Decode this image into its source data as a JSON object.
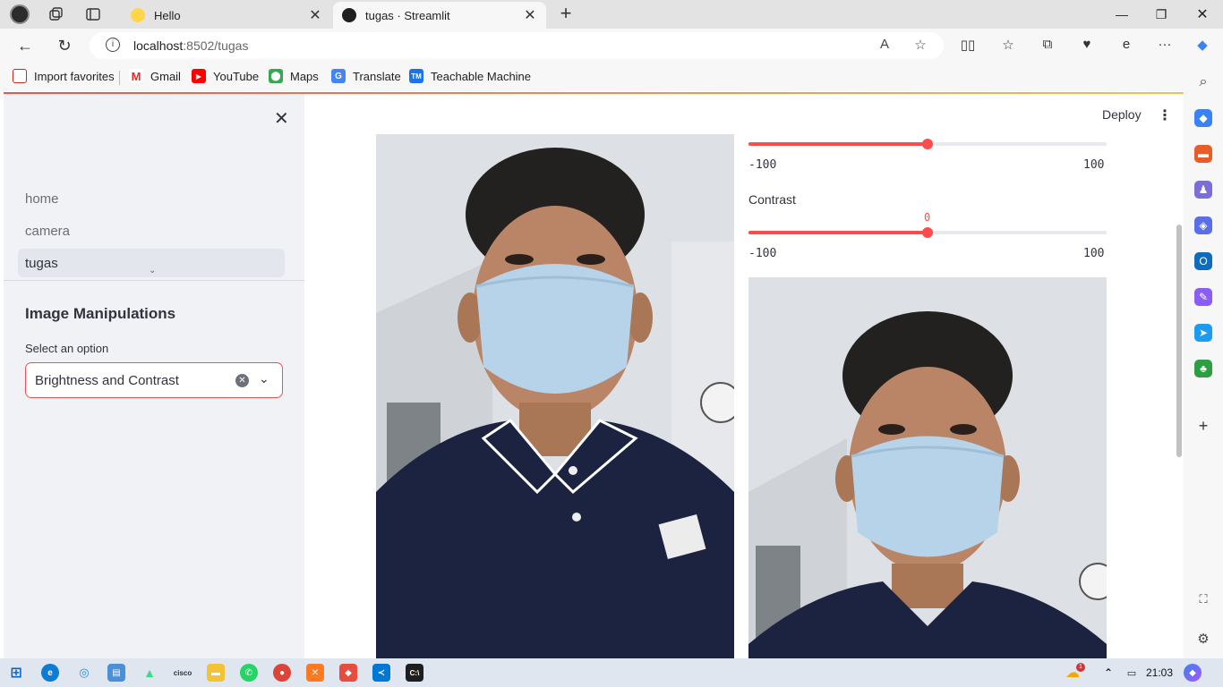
{
  "browser": {
    "tabs": [
      {
        "title": "Hello",
        "active": false
      },
      {
        "title": "tugas · Streamlit",
        "active": true
      }
    ],
    "url_host": "localhost",
    "url_rest": ":8502/tugas",
    "bookmarks": [
      "Import favorites",
      "Gmail",
      "YouTube",
      "Maps",
      "Translate",
      "Teachable Machine"
    ]
  },
  "sidebar": {
    "nav": [
      {
        "label": "home",
        "active": false
      },
      {
        "label": "camera",
        "active": false
      },
      {
        "label": "tugas",
        "active": true
      }
    ],
    "heading": "Image Manipulations",
    "select_label": "Select an option",
    "select_value": "Brightness and Contrast"
  },
  "header": {
    "deploy_label": "Deploy"
  },
  "main": {
    "brightness": {
      "min_label": "-100",
      "max_label": "100",
      "value": 0,
      "min": -100,
      "max": 100
    },
    "contrast": {
      "label": "Contrast",
      "value_label": "0",
      "min_label": "-100",
      "max_label": "100",
      "value": 0,
      "min": -100,
      "max": 100
    }
  },
  "taskbar": {
    "time": "21:03",
    "weather_badge": "1"
  },
  "colors": {
    "accent": "#ff4b4b",
    "sidebar_bg": "#f0f2f6",
    "shirt": "#1c2340",
    "mask": "#b6d3ea"
  }
}
